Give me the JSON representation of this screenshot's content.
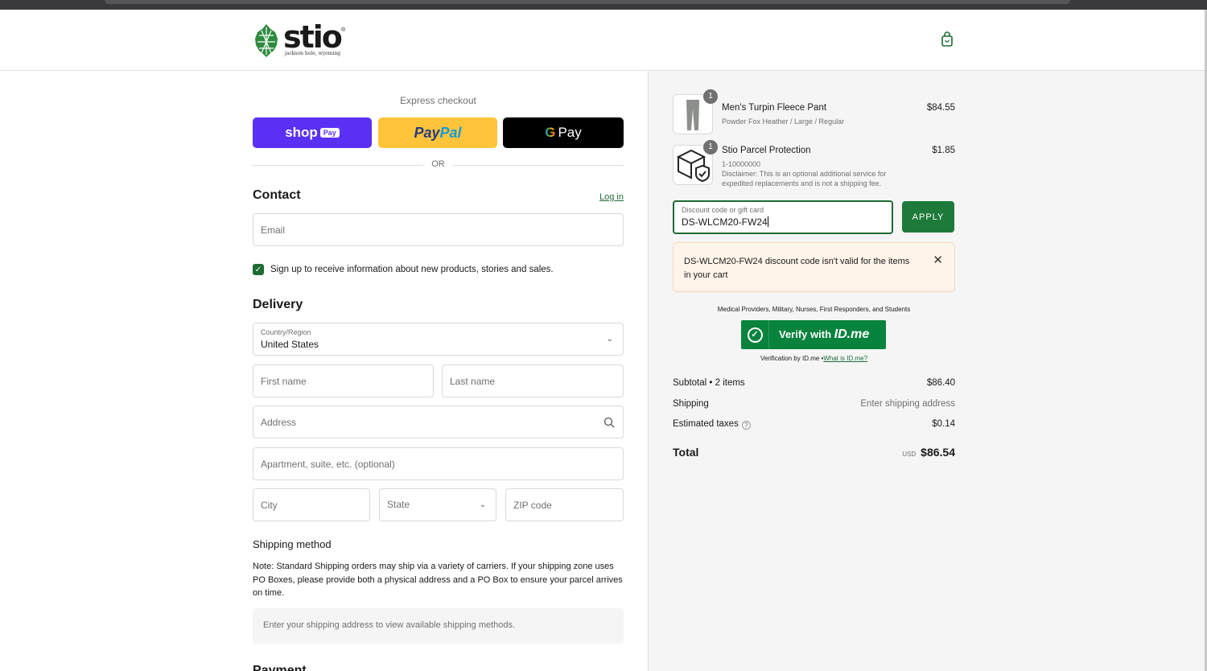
{
  "header": {
    "brand": "stio",
    "tagline": "jackson hole, wyoming",
    "cart_icon": "shopping-bag-icon"
  },
  "express": {
    "title": "Express checkout",
    "shop_pay": "shop",
    "shop_pay_badge": "Pay",
    "paypal_1": "Pay",
    "paypal_2": "Pal",
    "gpay_g": "G",
    "gpay_label": "Pay",
    "or": "OR"
  },
  "contact": {
    "title": "Contact",
    "login": "Log in",
    "email_placeholder": "Email",
    "newsletter_label": "Sign up to receive information about new products, stories and sales.",
    "newsletter_checked": true
  },
  "delivery": {
    "title": "Delivery",
    "country_label": "Country/Region",
    "country_value": "United States",
    "first_name": "First name",
    "last_name": "Last name",
    "address": "Address",
    "apartment": "Apartment, suite, etc. (optional)",
    "city": "City",
    "state": "State",
    "zip": "ZIP code"
  },
  "shipping": {
    "title": "Shipping method",
    "note": "Note: Standard Shipping orders may ship via a variety of carriers. If your shipping zone uses PO Boxes, please provide both a physical address and a PO Box to ensure your parcel arrives on time.",
    "placeholder": "Enter your shipping address to view available shipping methods."
  },
  "payment": {
    "title": "Payment"
  },
  "cart": {
    "items": [
      {
        "qty": "1",
        "name": "Men's Turpin Fleece Pant",
        "variant": "Powder Fox Heather / Large / Regular",
        "price": "$84.55"
      },
      {
        "qty": "1",
        "name": "Stio Parcel Protection",
        "variant": "1-10000000",
        "disclaimer_1": "Disclaimer: This is an optional additional service for",
        "disclaimer_2": "expedited replacements and is not a shipping fee.",
        "price": "$1.85"
      }
    ]
  },
  "discount": {
    "label": "Discount code or gift card",
    "value": "DS-WLCM20-FW24",
    "apply": "APPLY",
    "error": "DS-WLCM20-FW24 discount code isn't valid for the items in your cart"
  },
  "idme": {
    "top": "Medical Providers, Military, Nurses, First Responders, and Students",
    "btn_prefix": "Verify with",
    "btn_brand": "ID.me",
    "bottom_text": "Verification by ID.me •",
    "bottom_link": "What is ID.me?"
  },
  "summary": {
    "subtotal_label": "Subtotal • 2 items",
    "subtotal_value": "$86.40",
    "shipping_label": "Shipping",
    "shipping_value": "Enter shipping address",
    "taxes_label": "Estimated taxes",
    "taxes_value": "$0.14",
    "total_label": "Total",
    "currency": "USD",
    "total_value": "$86.54"
  },
  "colors": {
    "brand_green": "#1e6b34",
    "shop_pay": "#5a31f4",
    "paypal": "#ffc439",
    "idme": "#08833d",
    "error_bg": "#fff4ea"
  }
}
